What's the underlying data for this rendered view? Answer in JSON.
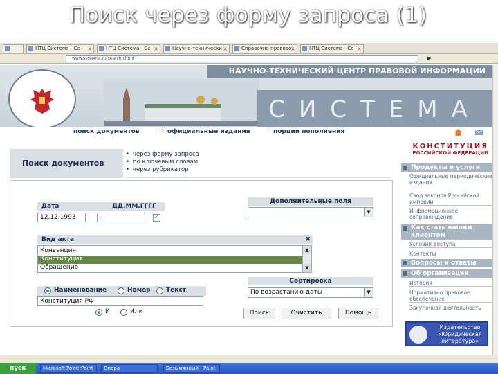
{
  "slide": {
    "title": "Поиск через форму запроса (1)"
  },
  "browser": {
    "tabs": [
      {
        "label": "НТЦ Система - Се"
      },
      {
        "label": "НТЦ Система - Се"
      },
      {
        "label": "Научно-технически"
      },
      {
        "label": "Справочно-правово"
      },
      {
        "label": "НТЦ Система - Се"
      }
    ],
    "url": "www.systema.ru/search.shtml"
  },
  "banner": {
    "org_name": "НАУЧНО-ТЕХНИЧЕСКИЙ ЦЕНТР ПРАВОВОЙ ИНФОРМАЦИИ",
    "brand": "СИСТЕМА"
  },
  "nav": {
    "items": [
      {
        "label": "поиск документов"
      },
      {
        "label": "официальные издания"
      },
      {
        "label": "порции пополнения"
      }
    ]
  },
  "search": {
    "panel_title": "Поиск документов",
    "methods": [
      "через форму запроса",
      "по ключевым словам",
      "через рубрикатор"
    ]
  },
  "form": {
    "date_label": "Дата",
    "date_format": "ДД.ММ.ГГГГ",
    "date_from": "12.12.1993",
    "date_sep": "-",
    "extra_fields_label": "Дополнительные поля",
    "act_type_label": "Вид акта",
    "act_types": [
      "Конвенция",
      "Конституция",
      "Обращение"
    ],
    "selected_act_type": "Конституция",
    "search_in": [
      "Наименование",
      "Номер",
      "Текст"
    ],
    "search_value": "Конституция  РФ",
    "logic": [
      "И",
      "Или"
    ],
    "sort_label": "Сортировка",
    "sort_value": "По возрастанию  даты",
    "buttons": {
      "search": "Поиск",
      "clear": "Очистить",
      "help": "Помощь"
    }
  },
  "sidebar": {
    "konst_title": "КОНСТИТУЦИЯ",
    "konst_sub": "РОССИЙСКОЙ ФЕДЕРАЦИИ",
    "sections": [
      {
        "label": "Продукты и услуги"
      },
      {
        "label": "Как стать нашим клиентом"
      },
      {
        "label": "Вопросы и ответы"
      },
      {
        "label": "Об организации"
      }
    ],
    "products": [
      "Официальные периодические издания",
      "Свод законов Российской империи",
      "Информационное сопровождение"
    ],
    "client": [
      "Условия доступа",
      "Контакты"
    ],
    "about": [
      "История",
      "Нормативно правовое обеспечение",
      "Закупочная деятельность"
    ],
    "publisher": "Издательство «Юридическая литература»"
  },
  "taskbar": {
    "start": "пуск",
    "items": [
      {
        "label": "Microsoft PowerPoint"
      },
      {
        "label": "Опера"
      },
      {
        "label": "Безымянный - Paint"
      }
    ]
  }
}
